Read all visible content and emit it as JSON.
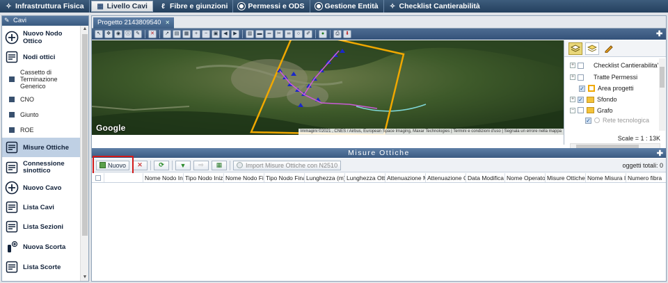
{
  "topnav": {
    "tabs": [
      {
        "label": "Infrastruttura Fisica",
        "active": false
      },
      {
        "label": "Livello Cavi",
        "active": true
      },
      {
        "label": "Fibre e giunzioni",
        "active": false
      },
      {
        "label": "Permessi e ODS",
        "active": false
      },
      {
        "label": "Gestione Entità",
        "active": false
      },
      {
        "label": "Checklist Cantierabilità",
        "active": false
      }
    ]
  },
  "sidebar": {
    "title": "Cavi",
    "items": {
      "nuovo_nodo_ottico": "Nuovo Nodo Ottico",
      "nodi_ottici": "Nodi ottici",
      "cassetto": "Cassetto di Terminazione Generico",
      "cno": "CNO",
      "giunto": "Giunto",
      "roe": "ROE",
      "misure_ottiche": "Misure Ottiche",
      "connessione_sinottico": "Connessione sinottico",
      "nuovo_cavo": "Nuovo Cavo",
      "lista_cavi": "Lista Cavi",
      "lista_sezioni": "Lista Sezioni",
      "nuova_scorta": "Nuova Scorta",
      "lista_scorte": "Lista Scorte"
    }
  },
  "project": {
    "tab_label": "Progetto 2143809540"
  },
  "map": {
    "google_logo": "Google",
    "attribution": "Immagini ©2021 , CNES / Airbus, European Space Imaging, Maxar Technologies | Termini e condizioni d'uso | Segnala un errore nella mappa",
    "scale_label": "Scale = 1 : 13K"
  },
  "layers": {
    "checklist": "Checklist Cantierabilita'",
    "tratte_permessi": "Tratte Permessi",
    "area_progetti": "Area progetti",
    "sfondo": "Sfondo",
    "grafo": "Grafo",
    "rete_tecnologica": "Rete tecnologica"
  },
  "misure": {
    "title": "Misure Ottiche",
    "nuovo_label": "Nuovo",
    "import_label": "Import Misure Ottiche con N2510",
    "total_label": "oggetti totali: 0",
    "columns": [
      "Nome Nodo Iniz",
      "Tipo Nodo Inizia",
      "Nome Nodo Fin",
      "Tipo Nodo Final",
      "Lunghezza (m)",
      "Lunghezza Ottic",
      "Attenuazione M",
      "Attenuazione Ot",
      "Data Modifica",
      "Nome Operator",
      "Misure Ottiche I",
      "Nome Misura In",
      "Numero fibra"
    ]
  },
  "colors": {
    "header_blue": "#3b5b82",
    "highlight_red": "#d31a1a",
    "area_outline": "#f0a800"
  }
}
